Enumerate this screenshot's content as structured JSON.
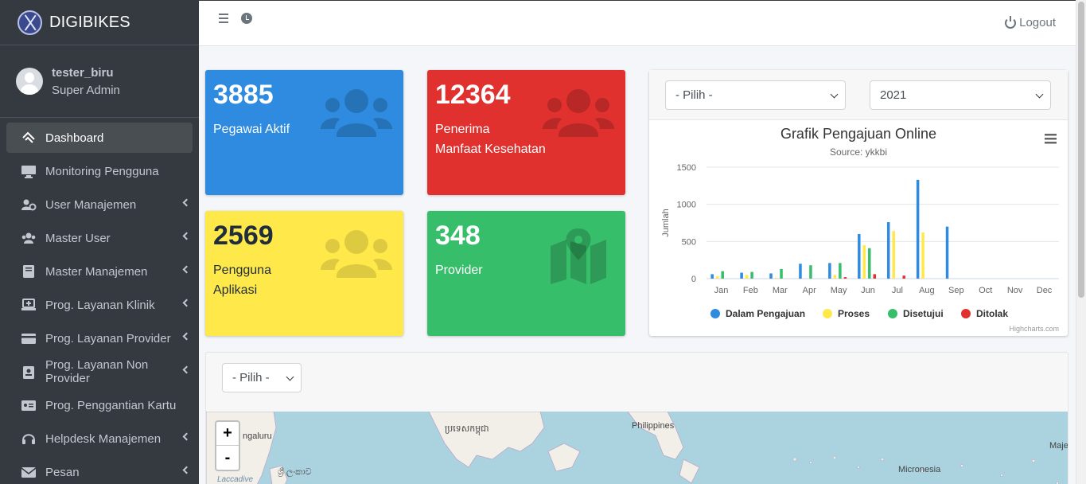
{
  "brand": {
    "name": "DIGIBIKES"
  },
  "user": {
    "name": "tester_biru",
    "role": "Super Admin"
  },
  "sidebar": {
    "items": [
      {
        "label": "Dashboard",
        "icon": "dashboard-icon",
        "active": true,
        "chevron": false
      },
      {
        "label": "Monitoring Pengguna",
        "icon": "desktop-icon",
        "active": false,
        "chevron": false
      },
      {
        "label": "User Manajemen",
        "icon": "users-cog-icon",
        "active": false,
        "chevron": true
      },
      {
        "label": "Master User",
        "icon": "users-icon",
        "active": false,
        "chevron": true
      },
      {
        "label": "Master Manajemen",
        "icon": "book-icon",
        "active": false,
        "chevron": true
      },
      {
        "label": "Prog. Layanan Klinik",
        "icon": "laptop-medical-icon",
        "active": false,
        "chevron": true
      },
      {
        "label": "Prog. Layanan Provider",
        "icon": "credit-card-icon",
        "active": false,
        "chevron": true
      },
      {
        "label": "Prog. Layanan Non Provider",
        "icon": "id-badge-icon",
        "active": false,
        "chevron": true
      },
      {
        "label": "Prog. Penggantian Kartu",
        "icon": "id-card-icon",
        "active": false,
        "chevron": false
      },
      {
        "label": "Helpdesk Manajemen",
        "icon": "headset-icon",
        "active": false,
        "chevron": true
      },
      {
        "label": "Pesan",
        "icon": "envelope-icon",
        "active": false,
        "chevron": true
      }
    ]
  },
  "topbar": {
    "logout_label": "Logout"
  },
  "stats": {
    "pegawai": {
      "value": "3885",
      "label": "Pegawai Aktif"
    },
    "penerima": {
      "value": "12364",
      "label_line1": "Penerima",
      "label_line2": "Manfaat Kesehatan"
    },
    "pengguna": {
      "value": "2569",
      "label_line1": "Pengguna",
      "label_line2": "Aplikasi"
    },
    "provider": {
      "value": "348",
      "label": "Provider"
    }
  },
  "chart_filters": {
    "month_selected": "- Pilih -",
    "year_selected": "2021"
  },
  "map_filter": {
    "selected": "- Pilih -"
  },
  "map": {
    "zoom_in": "+",
    "zoom_out": "-",
    "labels": {
      "bengaluru": "ngaluru",
      "cambodia": "ប្រទេសកម្ពុជា",
      "philippines": "Philippines",
      "micronesia": "Micronesia",
      "laccadive": "Laccadive",
      "srilanka": "ශ්‍රී ලංකාව",
      "maje": "Maje"
    }
  },
  "chart_data": {
    "type": "bar",
    "title": "Grafik Pengajuan Online",
    "subtitle": "Source: ykkbi",
    "ylabel": "Jumlah",
    "xlabel": "",
    "ylim": [
      0,
      1500
    ],
    "yticks": [
      0,
      500,
      1000,
      1500
    ],
    "categories": [
      "Jan",
      "Feb",
      "Mar",
      "Apr",
      "May",
      "Jun",
      "Jul",
      "Aug",
      "Sep",
      "Oct",
      "Nov",
      "Dec"
    ],
    "series": [
      {
        "name": "Dalam Pengajuan",
        "color": "#2f8be0",
        "values": [
          60,
          80,
          70,
          200,
          210,
          600,
          760,
          1330,
          700,
          0,
          0,
          0
        ]
      },
      {
        "name": "Proses",
        "color": "#ffe94a",
        "values": [
          30,
          50,
          10,
          0,
          50,
          450,
          640,
          620,
          0,
          0,
          0,
          0
        ]
      },
      {
        "name": "Disetujui",
        "color": "#37be6b",
        "values": [
          100,
          90,
          130,
          180,
          210,
          410,
          0,
          0,
          0,
          0,
          0,
          0
        ]
      },
      {
        "name": "Ditolak",
        "color": "#e0312f",
        "values": [
          0,
          0,
          0,
          0,
          20,
          60,
          40,
          0,
          0,
          0,
          0,
          0
        ]
      }
    ],
    "legend": "bottom",
    "credits": "Highcharts.com",
    "grid": true
  }
}
